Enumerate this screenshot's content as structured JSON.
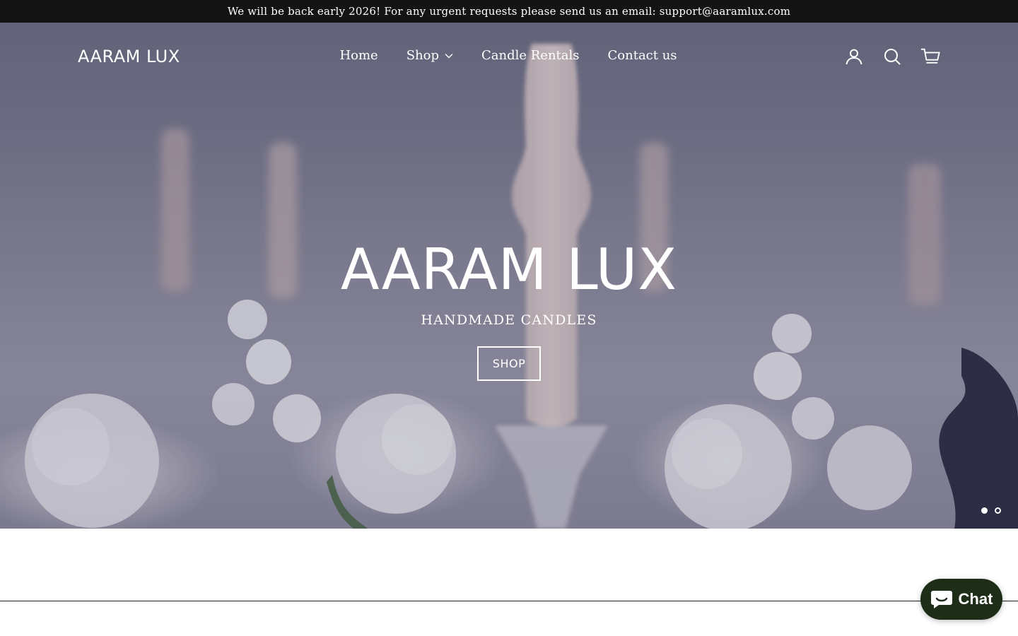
{
  "announcement": {
    "text": "We will be back early 2026! For any urgent requests please send us an email: support@aaramlux.com"
  },
  "header": {
    "logo": "AARAM LUX",
    "nav": [
      {
        "label": "Home"
      },
      {
        "label": "Shop",
        "has_dropdown": true
      },
      {
        "label": "Candle Rentals"
      },
      {
        "label": "Contact us"
      }
    ],
    "icons": [
      "account-icon",
      "search-icon",
      "cart-icon"
    ]
  },
  "hero": {
    "title": "AARAM LUX",
    "subtitle": "HANDMADE CANDLES",
    "button_label": "SHOP",
    "slides_total": 2,
    "active_slide": 1
  },
  "chat": {
    "label": "Chat",
    "accent": "#1e2d17"
  }
}
